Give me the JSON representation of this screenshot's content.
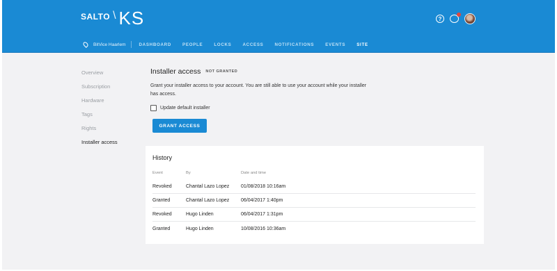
{
  "header": {
    "logo_brand": "SALTO",
    "logo_slash": "\\",
    "logo_product": "KS",
    "help_icon_glyph": "?",
    "site_name": "BitVice Haarlem",
    "nav_tabs": [
      {
        "label": "DASHBOARD"
      },
      {
        "label": "PEOPLE"
      },
      {
        "label": "LOCKS"
      },
      {
        "label": "ACCESS"
      },
      {
        "label": "NOTIFICATIONS"
      },
      {
        "label": "EVENTS"
      },
      {
        "label": "SITE"
      }
    ],
    "active_tab": "SITE",
    "accent_color": "#1a8ad4",
    "notification_dot_color": "#e5463d"
  },
  "sidebar": {
    "items": [
      {
        "label": "Overview"
      },
      {
        "label": "Subscription"
      },
      {
        "label": "Hardware"
      },
      {
        "label": "Tags"
      },
      {
        "label": "Rights"
      },
      {
        "label": "Installer access"
      }
    ],
    "active_item": "Installer access"
  },
  "main": {
    "title": "Installer access",
    "status": "NOT GRANTED",
    "description": "Grant your installer access to your account. You are still able to use your account while your installer has access.",
    "checkbox_label": "Update default installer",
    "checkbox_checked": false,
    "grant_button_label": "GRANT ACCESS"
  },
  "history": {
    "title": "History",
    "columns": [
      "Event",
      "By",
      "Date and time"
    ],
    "rows": [
      {
        "event": "Revoked",
        "by": "Chantal Lazo Lopez",
        "datetime": "01/08/2018 10:16am"
      },
      {
        "event": "Granted",
        "by": "Chantal Lazo Lopez",
        "datetime": "06/04/2017 1:40pm"
      },
      {
        "event": "Revoked",
        "by": "Hugo Linden",
        "datetime": "06/04/2017 1:31pm"
      },
      {
        "event": "Granted",
        "by": "Hugo Linden",
        "datetime": "10/08/2016 10:36am"
      }
    ]
  }
}
